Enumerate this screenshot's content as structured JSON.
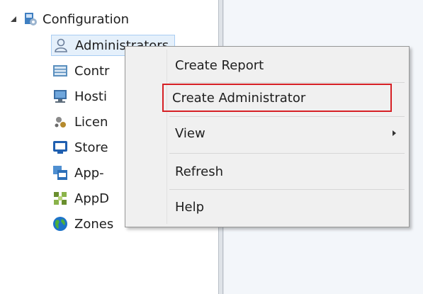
{
  "tree": {
    "root": {
      "label": "Configuration",
      "icon": "configuration-icon"
    },
    "items": [
      {
        "label": "Administrators",
        "icon": "administrator-user-icon",
        "selected": true
      },
      {
        "label": "Controllers",
        "icon": "controller-icon"
      },
      {
        "label": "Hosting",
        "icon": "hosting-monitor-icon"
      },
      {
        "label": "Licensing",
        "icon": "licensing-icon"
      },
      {
        "label": "StoreFront",
        "icon": "storefront-icon"
      },
      {
        "label": "App-V Publishing",
        "icon": "app-v-icon"
      },
      {
        "label": "AppDNA",
        "icon": "appdna-icon"
      },
      {
        "label": "Zones",
        "icon": "zones-globe-icon"
      }
    ],
    "visible_labels": [
      "Administrators",
      "Contr",
      "Hosti",
      "Licen",
      "Store",
      "App-",
      "AppD",
      "Zones"
    ]
  },
  "context_menu": {
    "items": [
      {
        "label": "Create Report"
      },
      {
        "label": "Create Administrator",
        "highlighted": true
      },
      {
        "label": "View",
        "has_submenu": true
      },
      {
        "label": "Refresh"
      },
      {
        "label": "Help"
      }
    ]
  },
  "colors": {
    "selection_bg": "#e5f0fb",
    "selection_border": "#a9cdf3",
    "highlight_outline": "#d62025",
    "menu_bg": "#f0f0f0",
    "right_pane_bg": "#f3f6fa"
  }
}
